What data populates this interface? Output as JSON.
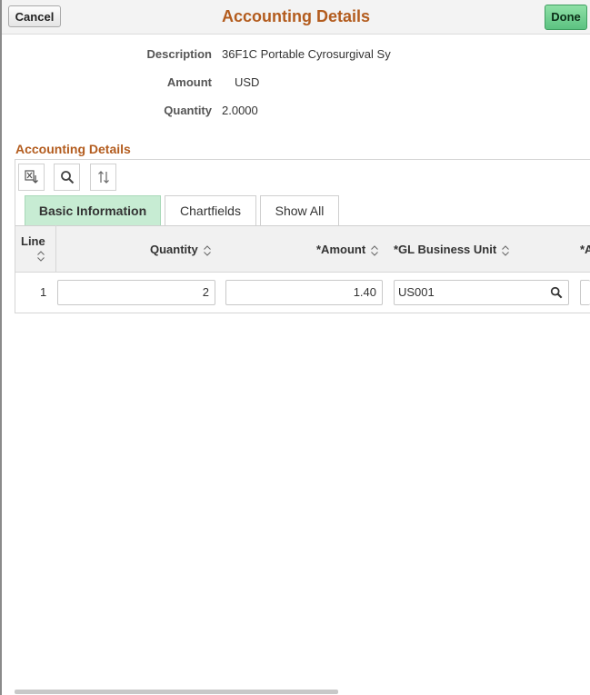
{
  "header": {
    "cancel_label": "Cancel",
    "title": "Accounting Details",
    "done_label": "Done"
  },
  "info": {
    "description_label": "Description",
    "description_value": "36F1C Portable Cyrosurgival Sy",
    "amount_label": "Amount",
    "amount_value": "USD",
    "quantity_label": "Quantity",
    "quantity_value": "2.0000"
  },
  "section": {
    "title": "Accounting Details",
    "toolbar": [
      "export-icon",
      "search-icon",
      "sort-icon"
    ]
  },
  "tabs": [
    {
      "label": "Basic Information",
      "active": true
    },
    {
      "label": "Chartfields",
      "active": false
    },
    {
      "label": "Show All",
      "active": false
    }
  ],
  "table": {
    "columns": {
      "line": "Line",
      "quantity": "Quantity",
      "amount": "*Amount",
      "gl_business_unit": "*GL Business Unit",
      "next_partial": "*A"
    },
    "rows": [
      {
        "line": "1",
        "quantity": "2",
        "amount": "1.40",
        "gl_business_unit": "US001"
      }
    ]
  },
  "colors": {
    "accent": "#b35c1e",
    "done_button": "#5cc281",
    "active_tab": "#c7ecd3"
  }
}
